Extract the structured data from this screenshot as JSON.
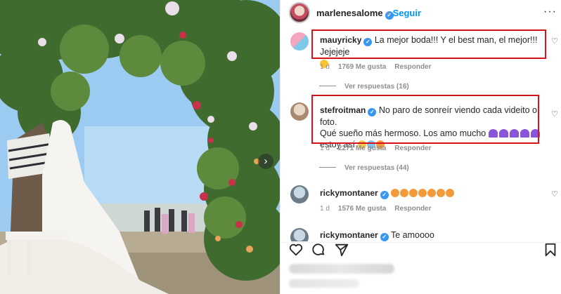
{
  "header": {
    "username": "marlenesalome",
    "follow_dot": "•",
    "follow_label": "Seguir",
    "more_label": "···",
    "verified_mark": "✓"
  },
  "comments": [
    {
      "username": "mauyricky",
      "text": "La mejor boda!!! Y el best man, el mejor!!! Jejejeje",
      "emojis": [
        "laughing-emoji"
      ],
      "age": "1 d",
      "likes": "1769 Me gusta",
      "reply_label": "Responder",
      "view_replies": "Ver respuestas (16)",
      "highlighted": true,
      "avatar_colors": [
        "#f4a6c0",
        "#7fc8e8"
      ]
    },
    {
      "username": "stefroitman",
      "text_line1": "No paro de sonreír viendo cada videito o foto.",
      "text_line2": "Qué sueño más hermoso. Los amo mucho",
      "text_line3": "estoy así",
      "emojis": [
        "purple-heart",
        "purple-heart",
        "purple-heart",
        "purple-heart",
        "purple-heart",
        "grimacing-face",
        "crying-face",
        "star-struck-face"
      ],
      "age": "1 d",
      "likes": "2271 Me gusta",
      "reply_label": "Responder",
      "view_replies": "Ver respuestas (44)",
      "highlighted": true,
      "avatar_colors": [
        "#e9d8c8",
        "#a88a6e"
      ]
    },
    {
      "username": "rickymontaner",
      "text": "",
      "emojis": [
        "star-struck-face",
        "star-struck-face",
        "star-struck-face",
        "star-struck-face",
        "star-struck-face",
        "star-struck-face",
        "star-struck-face"
      ],
      "age": "1 d",
      "likes": "1576 Me gusta",
      "reply_label": "Responder",
      "highlighted": false,
      "avatar_colors": [
        "#c9d9e4",
        "#6b7c88"
      ]
    },
    {
      "username": "rickymontaner",
      "text": "Te amoooo",
      "partially_visible": true
    }
  ],
  "actions": [
    "like-icon",
    "comment-icon",
    "share-icon",
    "save-icon"
  ],
  "colors": {
    "accent": "#0095f6",
    "highlight": "#d6131a",
    "verified": "#3897f0",
    "muted": "#8e8e8e"
  },
  "photo": {
    "next_label": "›"
  }
}
